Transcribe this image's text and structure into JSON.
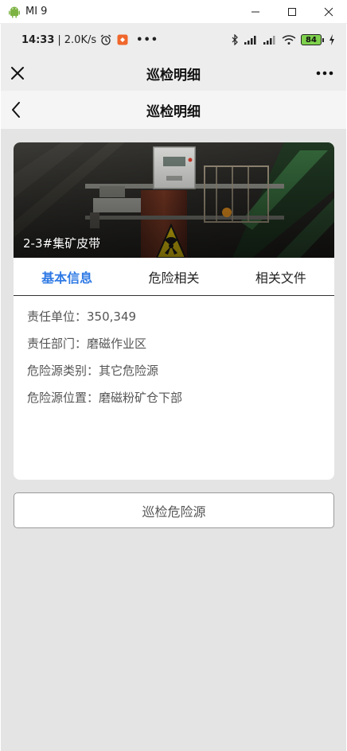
{
  "window": {
    "title": "MI 9",
    "minimize_icon": "minimize-icon",
    "maximize_icon": "maximize-icon",
    "close_icon": "close-icon"
  },
  "statusbar": {
    "time": "14:33",
    "speed": "2.0K/s",
    "battery": "84"
  },
  "wechat_nav": {
    "title": "巡检明细"
  },
  "header": {
    "title": "巡检明细"
  },
  "photo": {
    "caption": "2-3#集矿皮带"
  },
  "tabs": [
    {
      "label": "基本信息",
      "active": true
    },
    {
      "label": "危险相关",
      "active": false
    },
    {
      "label": "相关文件",
      "active": false
    }
  ],
  "info": {
    "unit": "责任单位：350,349",
    "department": "责任部门：磨磁作业区",
    "hazard_type": "危险源类别：其它危险源",
    "hazard_location": "危险源位置：磨磁粉矿仓下部"
  },
  "action": {
    "label": "巡检危险源"
  },
  "colors": {
    "accent": "#2f7ae5",
    "page_bg": "#e4e4e4"
  }
}
